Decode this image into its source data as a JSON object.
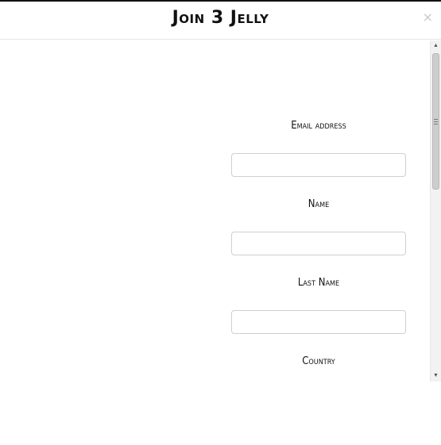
{
  "modal": {
    "title": "Join 3 Jelly",
    "close_label": "×"
  },
  "form": {
    "email_label": "Email address",
    "email_value": "",
    "name_label": "Name",
    "name_value": "",
    "last_name_label": "Last Name",
    "last_name_value": "",
    "country_label": "Country"
  },
  "icons": {
    "close": "close-icon",
    "scroll_up": "chevron-up-icon",
    "scroll_down": "chevron-down-icon"
  }
}
